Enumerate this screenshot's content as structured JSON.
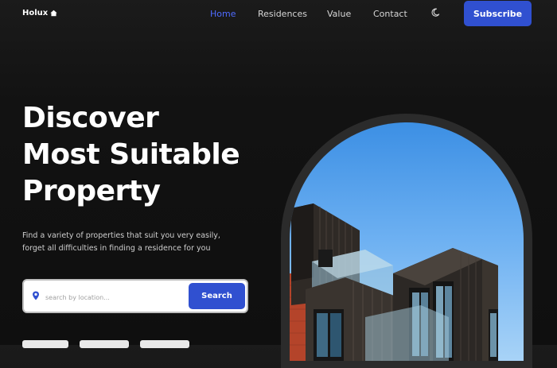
{
  "nav": {
    "logo": "Holux",
    "links": [
      {
        "label": "Home",
        "active": true
      },
      {
        "label": "Residences",
        "active": false
      },
      {
        "label": "Value",
        "active": false
      },
      {
        "label": "Contact",
        "active": false
      }
    ],
    "subscribe_label": "Subscribe"
  },
  "hero": {
    "title_lines": [
      "Discover",
      "Most Suitable",
      "Property"
    ],
    "description_lines": [
      "Find a variety of properties that suit you very easily,",
      "forget all difficulties in finding a residence for you"
    ]
  },
  "search": {
    "placeholder": "search by location...",
    "value": "",
    "button_label": "Search"
  },
  "colors": {
    "accent": "#3050d0",
    "active_link": "#4f6bff",
    "background": "#121212"
  },
  "icons": {
    "logo": "home-icon",
    "theme_toggle": "moon-icon",
    "search_field": "location-pin-icon"
  }
}
